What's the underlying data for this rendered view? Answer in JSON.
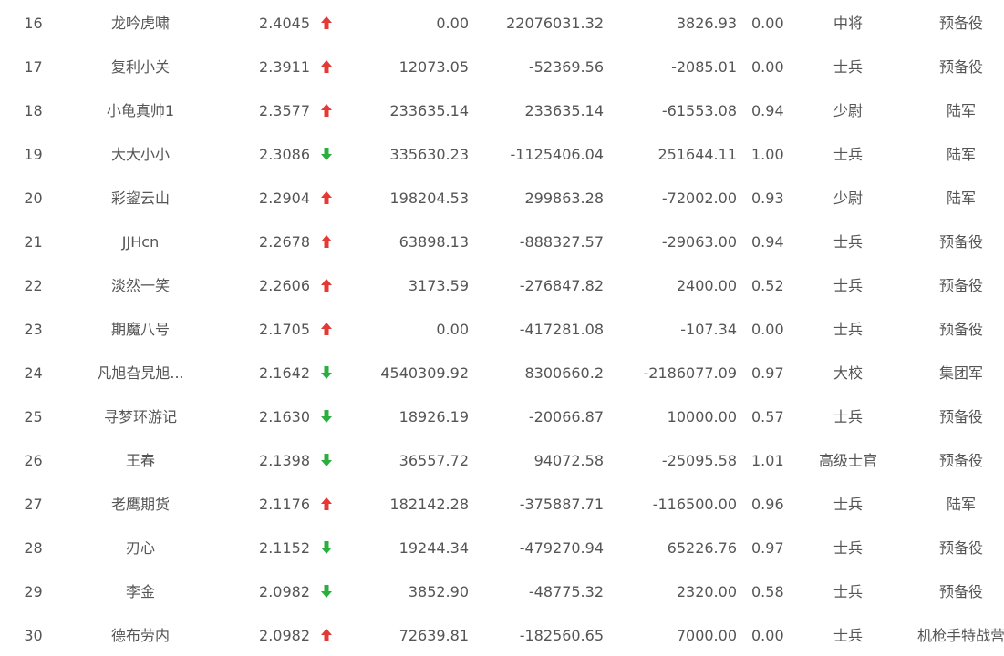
{
  "colors": {
    "up": "#e53935",
    "down": "#2aae3e",
    "text": "#555555"
  },
  "rows": [
    {
      "rank": "16",
      "name": "龙吟虎啸",
      "score": "2.4045",
      "trend": "up",
      "v1": "0.00",
      "v2": "22076031.32",
      "v3": "3826.93",
      "ratio": "0.00",
      "title": "中将",
      "unit": "预备役"
    },
    {
      "rank": "17",
      "name": "复利小关",
      "score": "2.3911",
      "trend": "up",
      "v1": "12073.05",
      "v2": "-52369.56",
      "v3": "-2085.01",
      "ratio": "0.00",
      "title": "士兵",
      "unit": "预备役"
    },
    {
      "rank": "18",
      "name": "小龟真帅1",
      "score": "2.3577",
      "trend": "up",
      "v1": "233635.14",
      "v2": "233635.14",
      "v3": "-61553.08",
      "ratio": "0.94",
      "title": "少尉",
      "unit": "陆军"
    },
    {
      "rank": "19",
      "name": "大大小小",
      "score": "2.3086",
      "trend": "down",
      "v1": "335630.23",
      "v2": "-1125406.04",
      "v3": "251644.11",
      "ratio": "1.00",
      "title": "士兵",
      "unit": "陆军"
    },
    {
      "rank": "20",
      "name": "彩鋆云山",
      "score": "2.2904",
      "trend": "up",
      "v1": "198204.53",
      "v2": "299863.28",
      "v3": "-72002.00",
      "ratio": "0.93",
      "title": "少尉",
      "unit": "陆军"
    },
    {
      "rank": "21",
      "name": "JJHcn",
      "score": "2.2678",
      "trend": "up",
      "v1": "63898.13",
      "v2": "-888327.57",
      "v3": "-29063.00",
      "ratio": "0.94",
      "title": "士兵",
      "unit": "预备役"
    },
    {
      "rank": "22",
      "name": "淡然一笑",
      "score": "2.2606",
      "trend": "up",
      "v1": "3173.59",
      "v2": "-276847.82",
      "v3": "2400.00",
      "ratio": "0.52",
      "title": "士兵",
      "unit": "预备役"
    },
    {
      "rank": "23",
      "name": "期魔八号",
      "score": "2.1705",
      "trend": "up",
      "v1": "0.00",
      "v2": "-417281.08",
      "v3": "-107.34",
      "ratio": "0.00",
      "title": "士兵",
      "unit": "预备役"
    },
    {
      "rank": "24",
      "name": "凡旭旮旯旭...",
      "score": "2.1642",
      "trend": "down",
      "v1": "4540309.92",
      "v2": "8300660.2",
      "v3": "-2186077.09",
      "ratio": "0.97",
      "title": "大校",
      "unit": "集团军"
    },
    {
      "rank": "25",
      "name": "寻梦环游记",
      "score": "2.1630",
      "trend": "down",
      "v1": "18926.19",
      "v2": "-20066.87",
      "v3": "10000.00",
      "ratio": "0.57",
      "title": "士兵",
      "unit": "预备役"
    },
    {
      "rank": "26",
      "name": "王春",
      "score": "2.1398",
      "trend": "down",
      "v1": "36557.72",
      "v2": "94072.58",
      "v3": "-25095.58",
      "ratio": "1.01",
      "title": "高级士官",
      "unit": "预备役"
    },
    {
      "rank": "27",
      "name": "老鹰期货",
      "score": "2.1176",
      "trend": "up",
      "v1": "182142.28",
      "v2": "-375887.71",
      "v3": "-116500.00",
      "ratio": "0.96",
      "title": "士兵",
      "unit": "陆军"
    },
    {
      "rank": "28",
      "name": "刃心",
      "score": "2.1152",
      "trend": "down",
      "v1": "19244.34",
      "v2": "-479270.94",
      "v3": "65226.76",
      "ratio": "0.97",
      "title": "士兵",
      "unit": "预备役"
    },
    {
      "rank": "29",
      "name": "李金",
      "score": "2.0982",
      "trend": "down",
      "v1": "3852.90",
      "v2": "-48775.32",
      "v3": "2320.00",
      "ratio": "0.58",
      "title": "士兵",
      "unit": "预备役"
    },
    {
      "rank": "30",
      "name": "德布劳内",
      "score": "2.0982",
      "trend": "up",
      "v1": "72639.81",
      "v2": "-182560.65",
      "v3": "7000.00",
      "ratio": "0.00",
      "title": "士兵",
      "unit": "机枪手特战营"
    }
  ]
}
